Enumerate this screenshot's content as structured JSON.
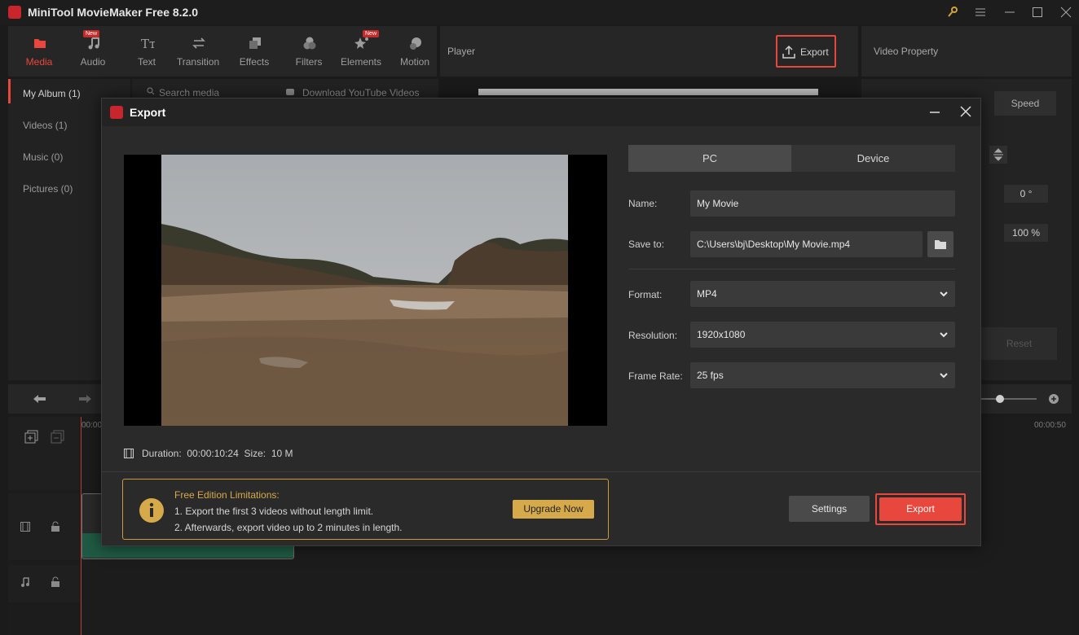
{
  "app": {
    "title": "MiniTool MovieMaker Free 8.2.0"
  },
  "toolbar": {
    "items": [
      {
        "label": "Media",
        "icon": "folder-icon"
      },
      {
        "label": "Audio",
        "icon": "music-note-icon",
        "badge": "New"
      },
      {
        "label": "Text",
        "icon": "text-icon"
      },
      {
        "label": "Transition",
        "icon": "transition-arrows-icon"
      },
      {
        "label": "Effects",
        "icon": "effects-icon"
      },
      {
        "label": "Filters",
        "icon": "filters-icon"
      },
      {
        "label": "Elements",
        "icon": "elements-stars-icon",
        "badge": "New"
      },
      {
        "label": "Motion",
        "icon": "motion-icon"
      }
    ]
  },
  "player": {
    "title": "Player",
    "export_label": "Export"
  },
  "video_property": {
    "title": "Video Property",
    "speed_tab": "Speed",
    "rotation_value": "0 °",
    "scale_value": "100 %",
    "reset_label": "Reset"
  },
  "sidebar": {
    "items": [
      {
        "label": "My Album (1)"
      },
      {
        "label": "Videos (1)"
      },
      {
        "label": "Music (0)"
      },
      {
        "label": "Pictures (0)"
      }
    ]
  },
  "media": {
    "search_placeholder": "Search media",
    "download_label": "Download YouTube Videos"
  },
  "timeline": {
    "time_start": "00:00",
    "time_end": "00:00:50"
  },
  "export_dialog": {
    "title": "Export",
    "duration_label": "Duration:",
    "duration_value": "00:00:10:24",
    "size_label": "Size:",
    "size_value": "10 M",
    "tabs": [
      "PC",
      "Device"
    ],
    "name_label": "Name:",
    "name_value": "My Movie",
    "save_label": "Save to:",
    "save_value": "C:\\Users\\bj\\Desktop\\My Movie.mp4",
    "format_label": "Format:",
    "format_value": "MP4",
    "resolution_label": "Resolution:",
    "resolution_value": "1920x1080",
    "framerate_label": "Frame Rate:",
    "framerate_value": "25 fps",
    "limit_title": "Free Edition Limitations:",
    "limit_line1": "1. Export the first 3 videos without length limit.",
    "limit_line2": "2. Afterwards, export video up to 2 minutes in length.",
    "upgrade_label": "Upgrade Now",
    "settings_label": "Settings",
    "export_label": "Export"
  },
  "colors": {
    "accent": "#e8473d",
    "gold": "#d6a94b"
  }
}
